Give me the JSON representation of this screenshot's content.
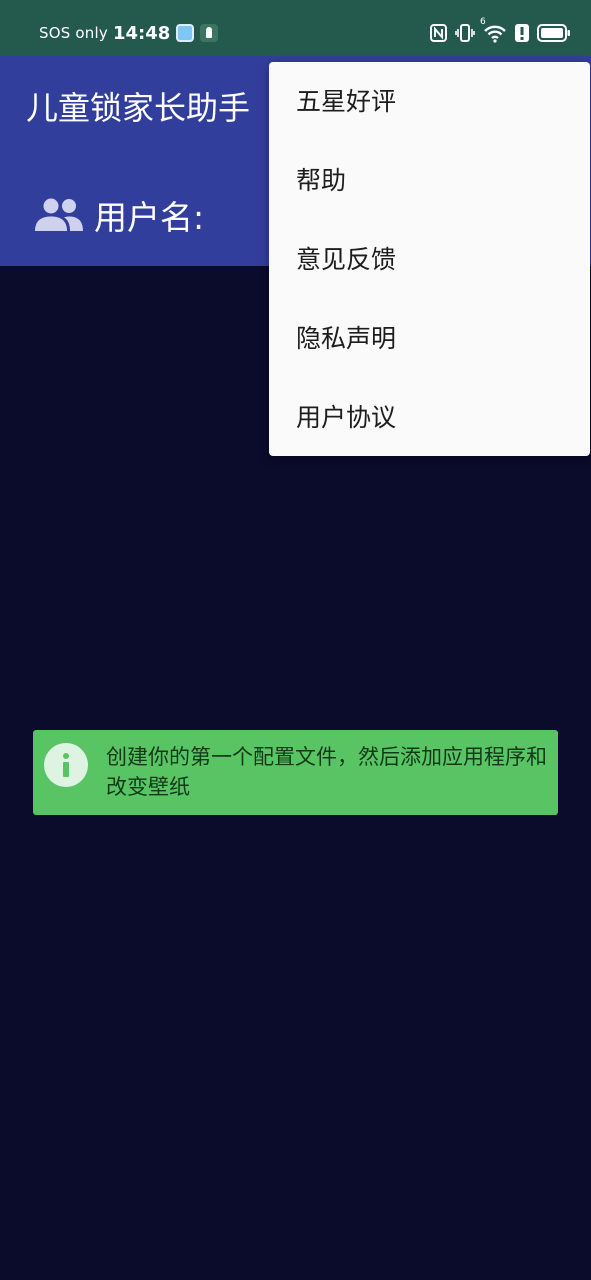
{
  "status_bar": {
    "carrier": "SOS only",
    "time": "14:48",
    "icons": [
      "app-notification-icon",
      "app-notification-icon",
      "nfc-icon",
      "vibrate-icon",
      "wifi-icon",
      "alert-icon",
      "battery-icon"
    ],
    "wifi_badge": "6"
  },
  "header": {
    "title": "儿童锁家长助手",
    "user_label": "用户名:",
    "user_icon": "group-icon"
  },
  "menu": {
    "items": [
      {
        "label": "五星好评"
      },
      {
        "label": "帮助"
      },
      {
        "label": "意见反馈"
      },
      {
        "label": "隐私声明"
      },
      {
        "label": "用户协议"
      }
    ]
  },
  "banner": {
    "icon": "info-icon",
    "text": "创建你的第一个配置文件，然后添加应用程序和改变壁纸"
  },
  "colors": {
    "status_bar": "#245a4e",
    "header": "#323e9c",
    "background": "#0b0b2c",
    "banner": "#59c464",
    "menu": "#fafafa"
  }
}
